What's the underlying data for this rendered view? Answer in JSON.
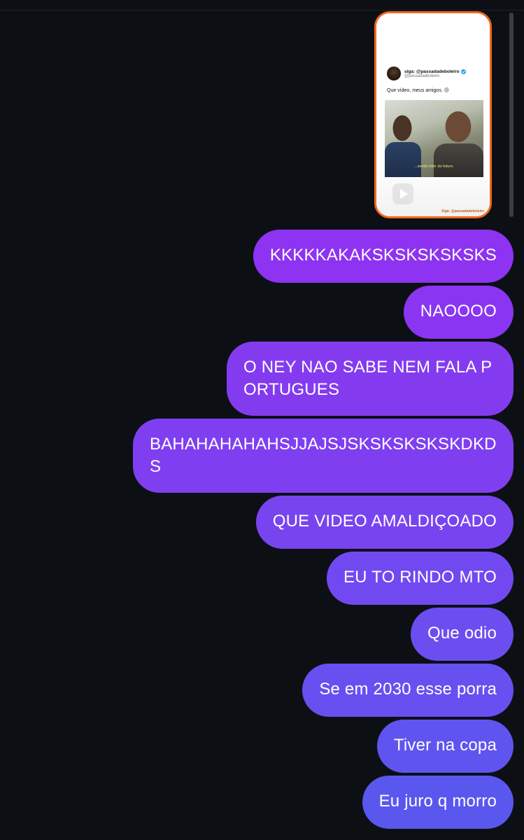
{
  "shared_post": {
    "author_name": "siga: @passadadeboleiro",
    "author_handle": "@passadadboleiro",
    "caption": "Que vídeo, meus amigos. 😔",
    "video_subtitle": "...sendo líder do futuro.",
    "footer_watermark": "Siga: @passadadeboleiro",
    "border_color": "#f2671e"
  },
  "messages": [
    {
      "text": "KKKKKAKAKSKSKSKSKSKS",
      "color": "#8d33f1"
    },
    {
      "text": "NAOOOO",
      "color": "#8a35f1"
    },
    {
      "text": "O NEY NAO SABE NEM FALA PORTUGUES",
      "color": "#843bf0"
    },
    {
      "text": "BAHAHAHAHAHSJJAJSJSKSKSKSKSKDKDS",
      "color": "#7f3ff0"
    },
    {
      "text": "QUE VIDEO AMALDIÇOADO",
      "color": "#7844f0"
    },
    {
      "text": "EU TO RINDO MTO",
      "color": "#7249f0"
    },
    {
      "text": "Que odio",
      "color": "#6c4df0"
    },
    {
      "text": "Se em 2030 esse porra",
      "color": "#6650f0"
    },
    {
      "text": "Tiver na copa",
      "color": "#6054f0"
    },
    {
      "text": "Eu juro q morro",
      "color": "#5a57ef"
    }
  ]
}
